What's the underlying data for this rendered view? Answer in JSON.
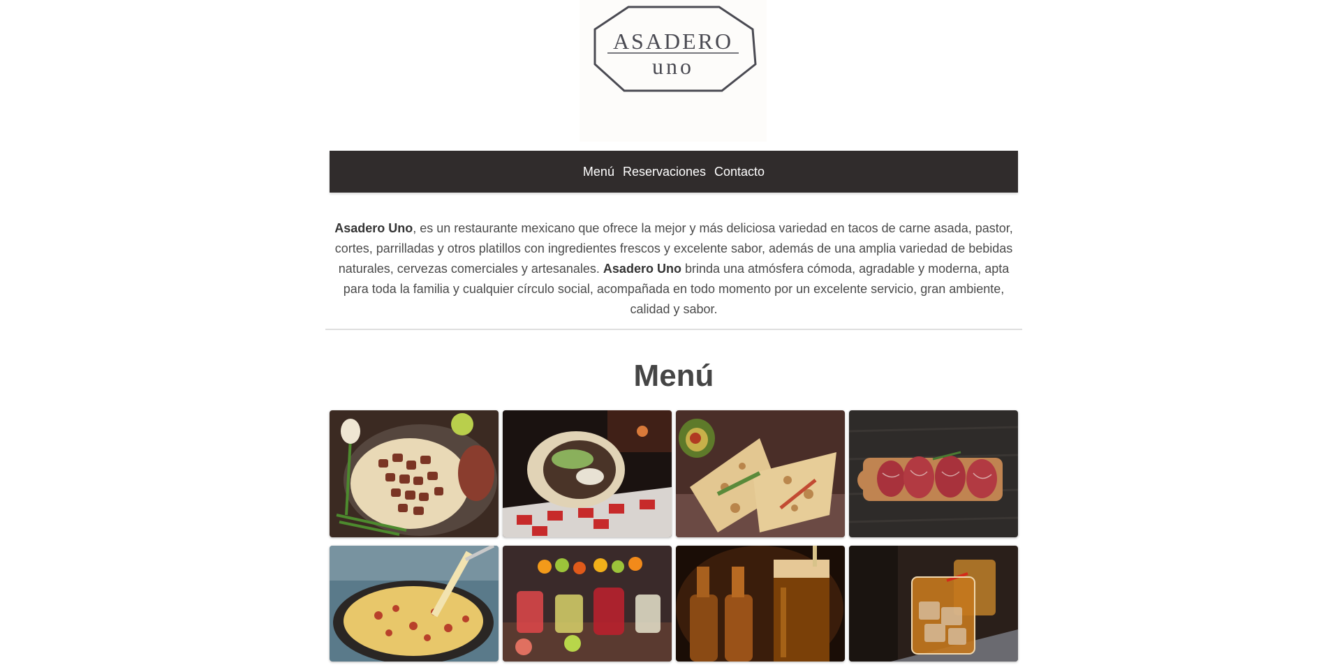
{
  "logo": {
    "line1": "ASADERO",
    "line2": "uno"
  },
  "nav": {
    "items": [
      "Menú",
      "Reservaciones",
      "Contacto"
    ]
  },
  "intro": {
    "brand": "Asadero Uno",
    "part1": ", es un restaurante mexicano que ofrece la mejor y más deliciosa variedad en tacos de carne asada, pastor, cortes, parrilladas y otros platillos con ingredientes frescos y excelente sabor, además de una amplia variedad de bebidas naturales, cervezas comerciales y artesanales. ",
    "part2": " brinda una atmósfera cómoda, agradable y moderna, apta para toda la familia y cualquier círculo social, acompañada en todo momento por un excelente servicio, gran ambiente, calidad y sabor."
  },
  "menu": {
    "title": "Menú"
  },
  "colors": {
    "nav_bg": "#302c2c",
    "logo_ink": "#4a4a52",
    "logo_bg": "#fdfcfa",
    "divider": "#dedede"
  }
}
